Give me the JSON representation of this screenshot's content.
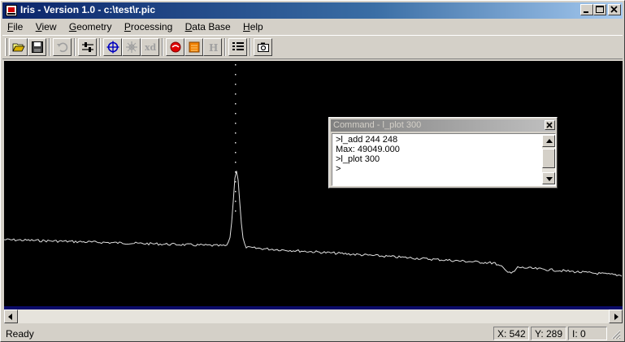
{
  "window": {
    "title": "Iris - Version 1.0 - c:\\test\\r.pic"
  },
  "menu": {
    "items": [
      {
        "label": "File",
        "accel": "F"
      },
      {
        "label": "View",
        "accel": "V"
      },
      {
        "label": "Geometry",
        "accel": "G"
      },
      {
        "label": "Processing",
        "accel": "P"
      },
      {
        "label": "Data Base",
        "accel": "D"
      },
      {
        "label": "Help",
        "accel": "H"
      }
    ]
  },
  "toolbar": {
    "xd_label": "xd",
    "h_label": "H",
    "icons": [
      "open-folder-icon",
      "save-disk-icon",
      "undo-icon",
      "threshold-sliders-icon",
      "crosshair-target-icon",
      "registration-star-icon",
      "xd-icon",
      "red-circle-icon",
      "orange-square-icon",
      "histogram-h-icon",
      "list-icon",
      "camera-icon"
    ]
  },
  "command_window": {
    "title": "Command - l_plot 300",
    "lines": [
      ">l_add 244 248",
      "Max: 49049.000",
      ">l_plot 300",
      ">"
    ]
  },
  "status": {
    "text": "Ready",
    "x": "X: 542",
    "y": "Y: 289",
    "i": "I: 0"
  },
  "colors": {
    "title_active": "#0a246a",
    "title_inactive": "#808080",
    "canvas": "#000000",
    "plot_line": "#e0e0e0",
    "face": "#d4d0c8"
  }
}
